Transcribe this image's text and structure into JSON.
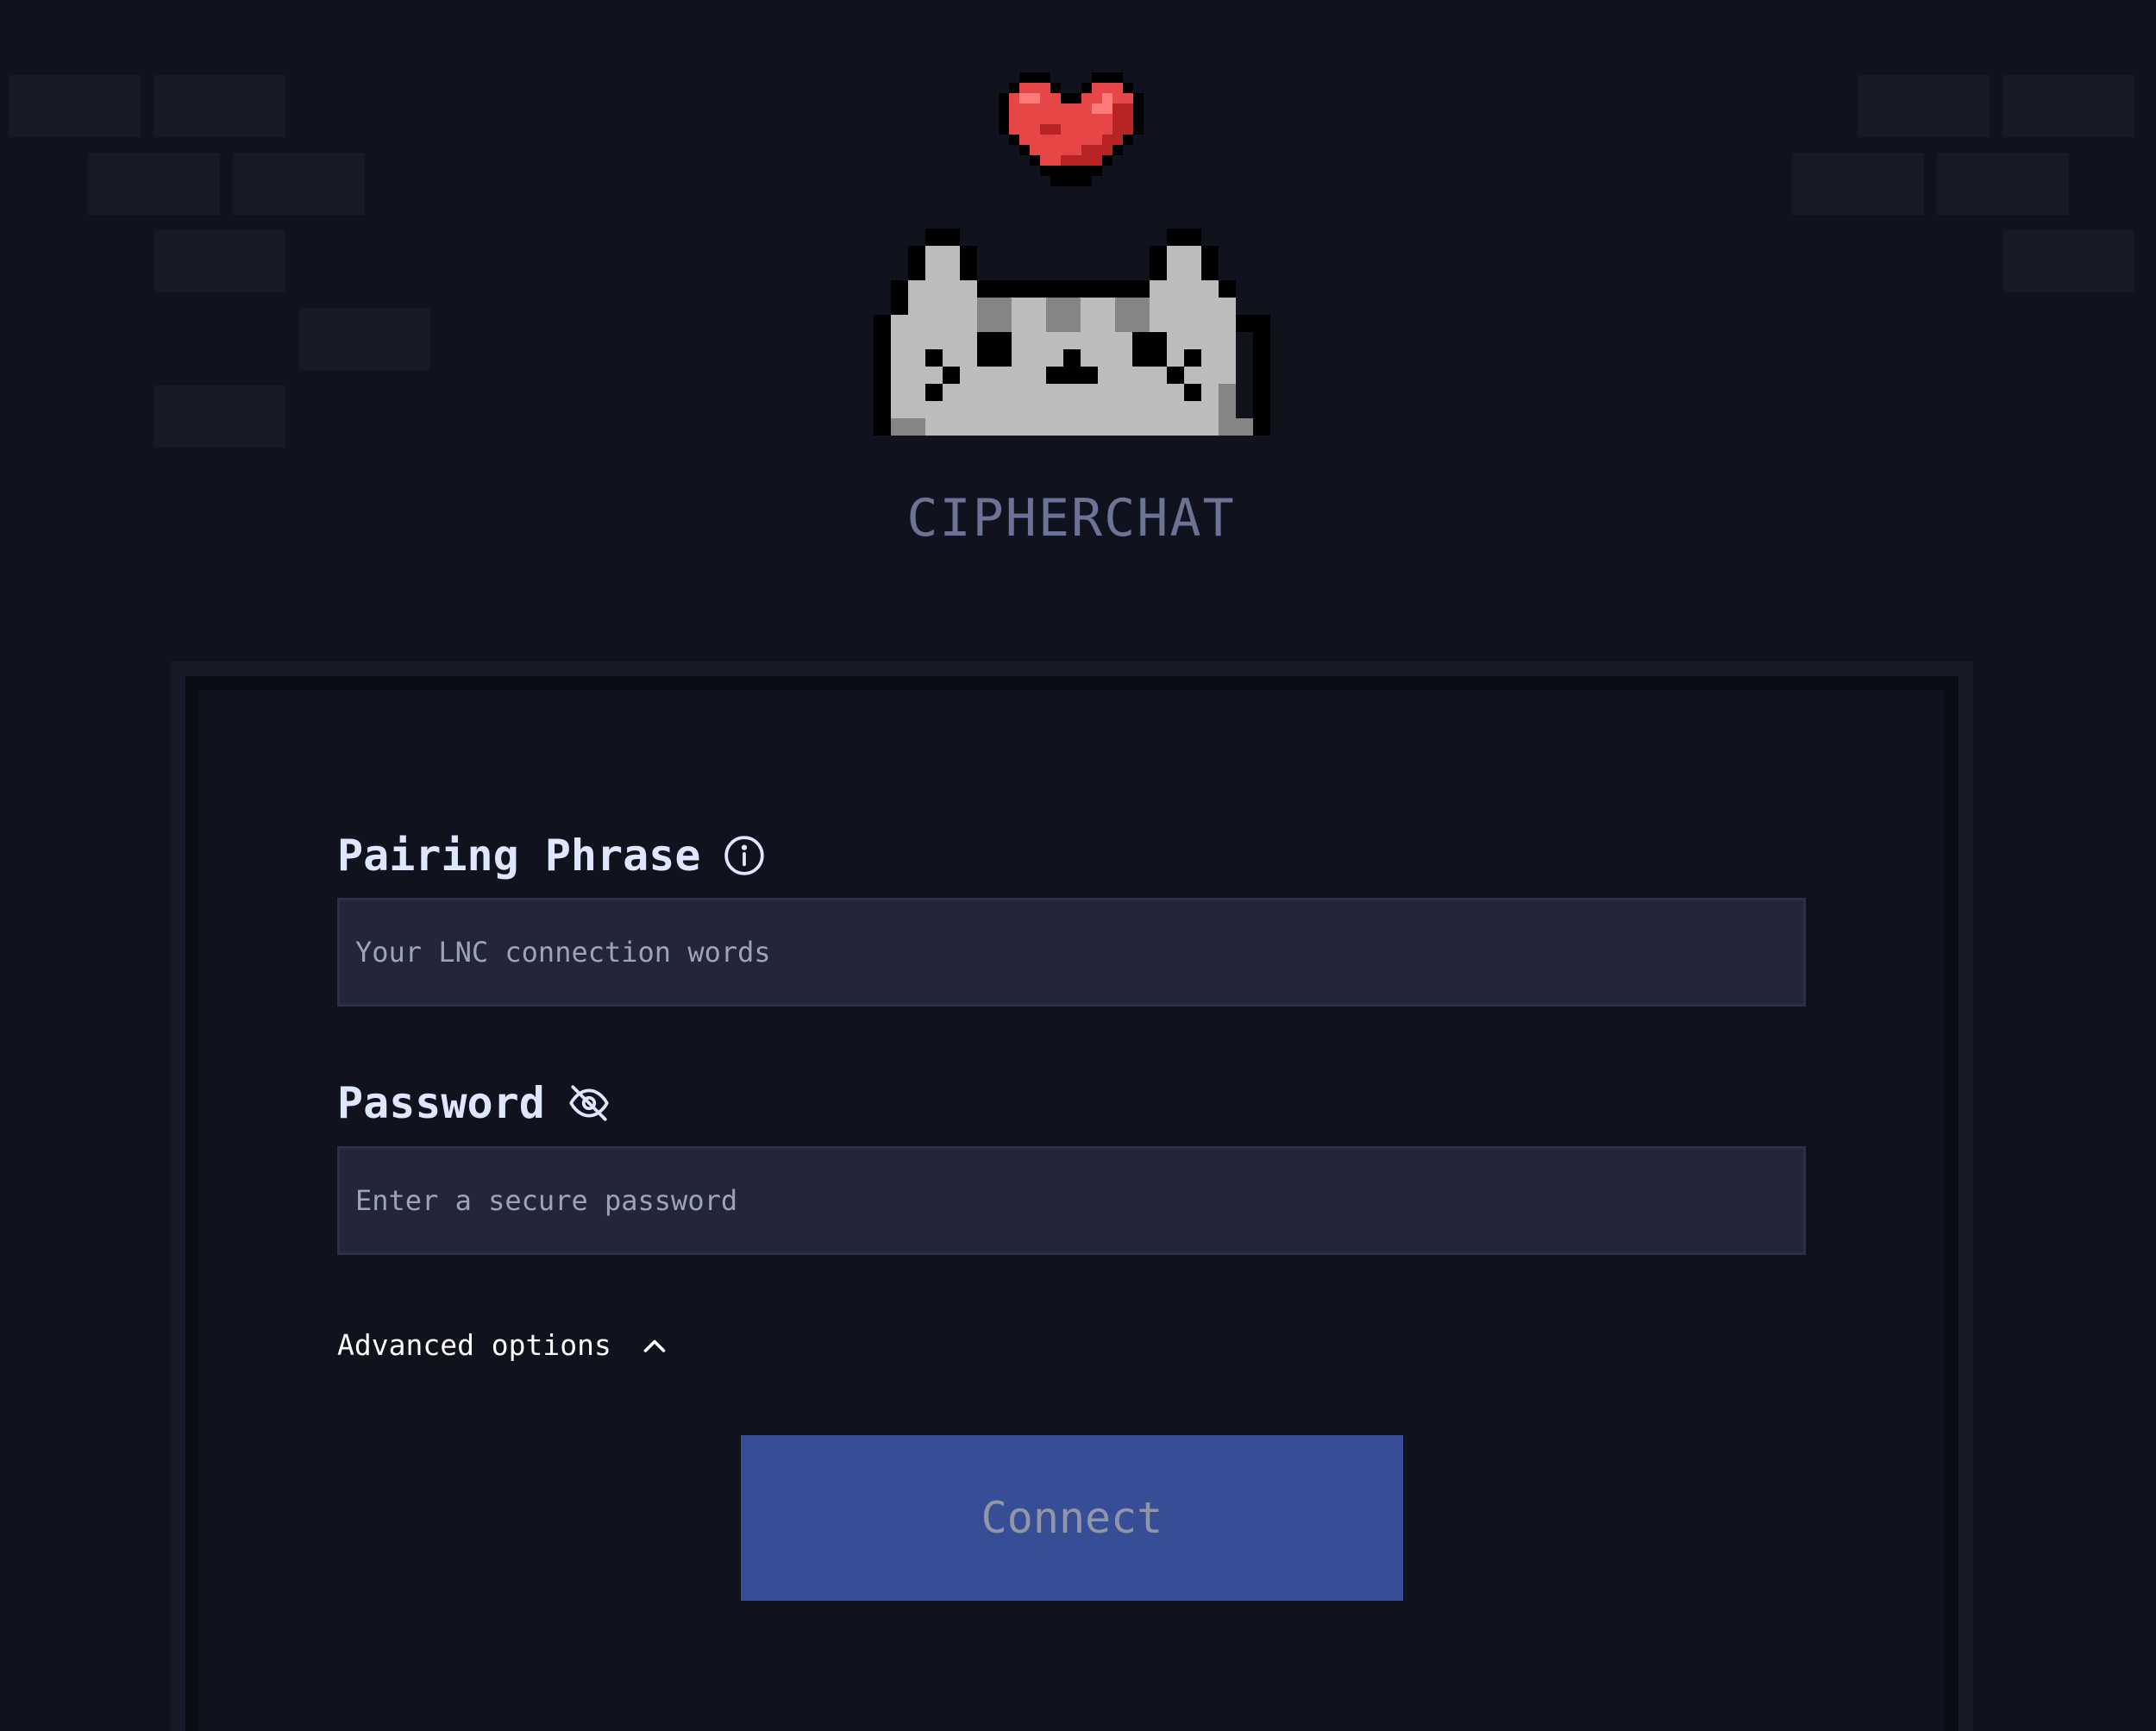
{
  "app": {
    "title": "CIPHERCHAT"
  },
  "form": {
    "pairing_phrase": {
      "label": "Pairing Phrase",
      "placeholder": "Your LNC connection words",
      "value": "",
      "icon": "info-icon"
    },
    "password": {
      "label": "Password",
      "placeholder": "Enter a secure password",
      "value": "",
      "icon": "eye-off-icon"
    },
    "advanced_options": {
      "label": "Advanced options",
      "icon": "chevron-up-icon"
    },
    "connect_button": {
      "label": "Connect"
    }
  },
  "colors": {
    "background": "#10121d",
    "input_background": "#23253b",
    "button_background": "#374e97",
    "label_text": "#dfe6ff",
    "title_text": "#6c7394",
    "heart_red": "#e64646"
  }
}
